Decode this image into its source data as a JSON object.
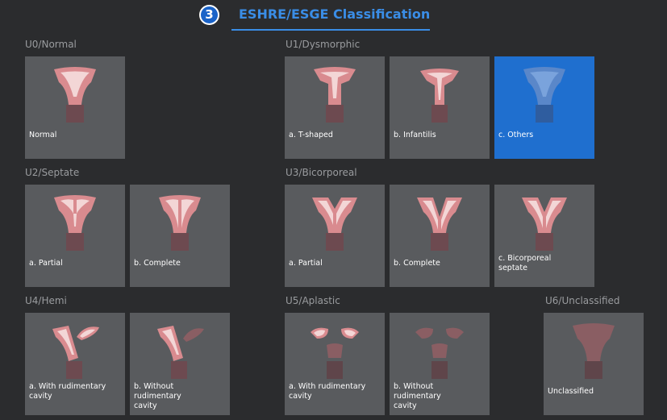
{
  "header": {
    "step": "3",
    "title": "ESHRE/ESGE Classification"
  },
  "groups": {
    "u0": {
      "label": "U0/Normal",
      "items": [
        "Normal"
      ]
    },
    "u1": {
      "label": "U1/Dysmorphic",
      "items": [
        "a. T-shaped",
        "b. Infantilis",
        "c. Others"
      ]
    },
    "u2": {
      "label": "U2/Septate",
      "items": [
        "a. Partial",
        "b. Complete"
      ]
    },
    "u3": {
      "label": "U3/Bicorporeal",
      "items": [
        "a. Partial",
        "b. Complete",
        "c. Bicorporeal septate"
      ]
    },
    "u4": {
      "label": "U4/Hemi",
      "items": [
        "a. With rudimentary cavity",
        "b. Without rudimentary cavity"
      ]
    },
    "u5": {
      "label": "U5/Aplastic",
      "items": [
        "a. With rudimentary cavity",
        "b. Without rudimentary cavity"
      ]
    },
    "u6": {
      "label": "U6/Unclassified",
      "items": [
        "Unclassified"
      ]
    }
  },
  "selected": "c. Others",
  "colors": {
    "tile": "#595b5e",
    "selected": "#1f6fcf",
    "accent": "#3a8de6",
    "uterus": "#d98b8f",
    "cavity": "#f3d6d6",
    "cervix": "#7a5358"
  }
}
